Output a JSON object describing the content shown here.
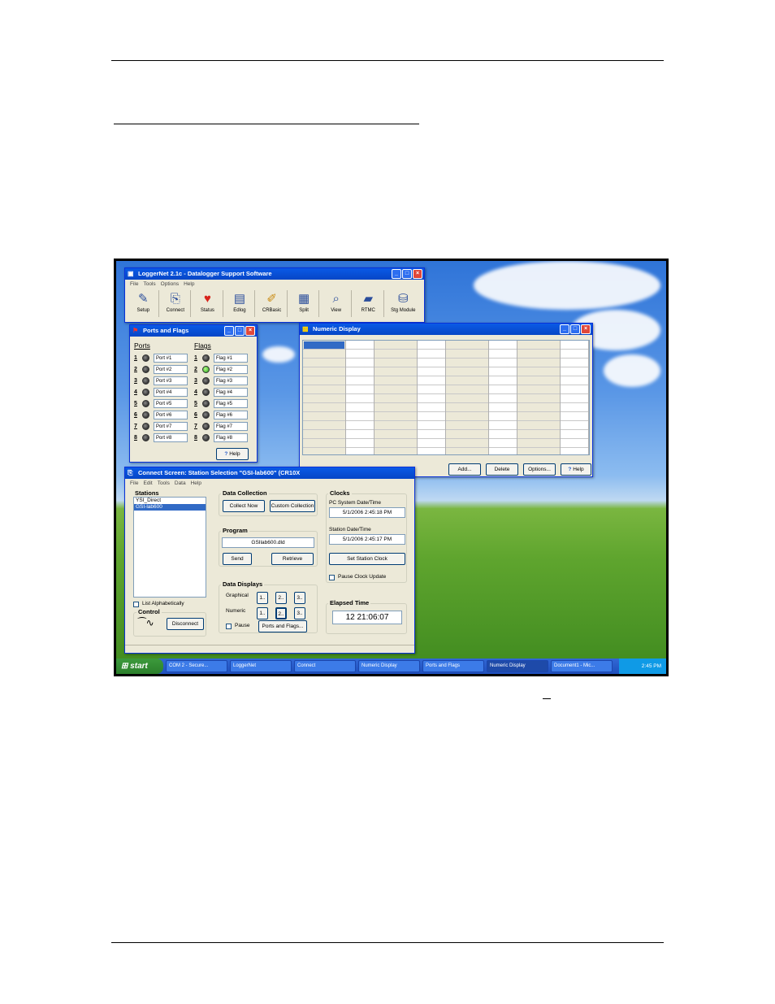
{
  "main_window": {
    "title": "LoggerNet 2.1c - Datalogger Support Software",
    "menu": [
      "File",
      "Tools",
      "Options",
      "Help"
    ],
    "tools": [
      {
        "label": "Setup",
        "icon": "setup-icon"
      },
      {
        "label": "Connect",
        "icon": "connect-icon"
      },
      {
        "label": "Status",
        "icon": "status-icon"
      },
      {
        "label": "Edlog",
        "icon": "edlog-icon"
      },
      {
        "label": "CRBasic",
        "icon": "crbasic-icon"
      },
      {
        "label": "Split",
        "icon": "split-icon"
      },
      {
        "label": "View",
        "icon": "view-icon"
      },
      {
        "label": "RTMC",
        "icon": "rtmc-icon"
      },
      {
        "label": "Stg Module",
        "icon": "storage-module-icon"
      }
    ]
  },
  "ports_flags": {
    "title": "Ports and Flags",
    "ports_heading": "Ports",
    "flags_heading": "Flags",
    "rows": [
      {
        "num": "1",
        "port": "Port #1",
        "flag": "Flag #1",
        "flag_on": false
      },
      {
        "num": "2",
        "port": "Port #2",
        "flag": "Flag #2",
        "flag_on": true
      },
      {
        "num": "3",
        "port": "Port #3",
        "flag": "Flag #3",
        "flag_on": false
      },
      {
        "num": "4",
        "port": "Port #4",
        "flag": "Flag #4",
        "flag_on": false
      },
      {
        "num": "5",
        "port": "Port #5",
        "flag": "Flag #5",
        "flag_on": false
      },
      {
        "num": "6",
        "port": "Port #6",
        "flag": "Flag #6",
        "flag_on": false
      },
      {
        "num": "7",
        "port": "Port #7",
        "flag": "Flag #7",
        "flag_on": false
      },
      {
        "num": "8",
        "port": "Port #8",
        "flag": "Flag #8",
        "flag_on": false
      }
    ],
    "help_label": "Help"
  },
  "numeric_display": {
    "title": "Numeric Display",
    "add_label": "Add...",
    "delete_label": "Delete",
    "options_label": "Options...",
    "help_label": "Help"
  },
  "connect_screen": {
    "title": "Connect Screen: Station Selection \"GSI-lab600\" (CR10X",
    "menu": [
      "File",
      "Edit",
      "Tools",
      "Data",
      "Help"
    ],
    "stations_title": "Stations",
    "stations": [
      "YSI_Direct",
      "GSI-lab600"
    ],
    "list_alpha_label": "List Alphabetically",
    "control_title": "Control",
    "disconnect_label": "Disconnect",
    "data_collection_title": "Data Collection",
    "collect_now_label": "Collect Now",
    "custom_collection_label": "Custom Collection",
    "program_title": "Program",
    "program_file": "GSIlab600.dld",
    "send_label": "Send",
    "retrieve_label": "Retrieve",
    "data_displays_title": "Data Displays",
    "graphical_label": "Graphical",
    "numeric_label": "Numeric",
    "btn1": "1..",
    "btn2": "2..",
    "btn3": "3..",
    "pause_label": "Pause",
    "ports_flags_label": "Ports and Flags...",
    "clocks_title": "Clocks",
    "pc_time_label": "PC System Date/Time",
    "pc_time": "5/1/2006 2:45:18 PM",
    "station_time_label": "Station Date/Time",
    "station_time": "5/1/2006 2:45:17 PM",
    "set_clock_label": "Set Station Clock",
    "pause_clock_label": "Pause Clock Update",
    "elapsed_title": "Elapsed Time",
    "elapsed_time": "12 21:06:07"
  },
  "taskbar": {
    "start_label": "start",
    "tasks": [
      "COM 2 - Secure...",
      "LoggerNet",
      "Connect",
      "Numeric Display",
      "Ports and Flags",
      "Numeric Display",
      "Document1 - Mic..."
    ],
    "clock": "2:45 PM"
  }
}
